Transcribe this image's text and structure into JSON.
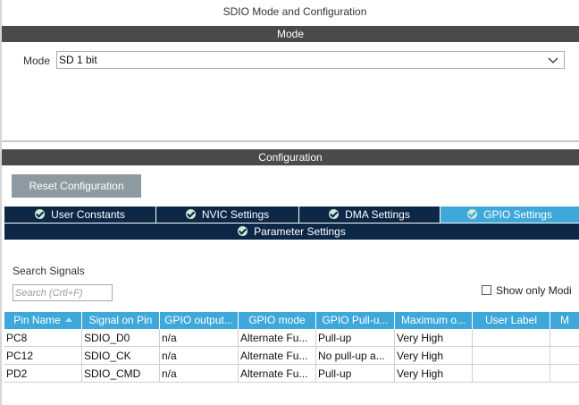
{
  "window_title": "SDIO Mode and Configuration",
  "mode_section": {
    "header": "Mode",
    "mode_label": "Mode",
    "mode_value": "SD 1 bit"
  },
  "config_section": {
    "header": "Configuration",
    "reset_button": "Reset Configuration",
    "tabs": [
      {
        "label": "User Constants",
        "active": false
      },
      {
        "label": "NVIC Settings",
        "active": false
      },
      {
        "label": "DMA Settings",
        "active": false
      },
      {
        "label": "GPIO Settings",
        "active": true
      },
      {
        "label": "Parameter Settings",
        "active": false
      }
    ],
    "search_label": "Search Signals",
    "search_placeholder": "Search (Crtl+F)",
    "show_only_label": "Show only Modi"
  },
  "table": {
    "columns": [
      "Pin Name",
      "Signal on Pin",
      "GPIO output...",
      "GPIO mode",
      "GPIO Pull-u...",
      "Maximum o...",
      "User Label",
      "M"
    ],
    "rows": [
      [
        "PC8",
        "SDIO_D0",
        "n/a",
        "Alternate Fu...",
        "Pull-up",
        "Very High",
        "",
        ""
      ],
      [
        "PC12",
        "SDIO_CK",
        "n/a",
        "Alternate Fu...",
        "No pull-up a...",
        "Very High",
        "",
        ""
      ],
      [
        "PD2",
        "SDIO_CMD",
        "n/a",
        "Alternate Fu...",
        "Pull-up",
        "Very High",
        "",
        ""
      ]
    ]
  },
  "colors": {
    "section_bar": "#4a4a4a",
    "tab_dark": "#0d2747",
    "accent": "#3ea8da",
    "reset_button": "#8e9aa1"
  }
}
